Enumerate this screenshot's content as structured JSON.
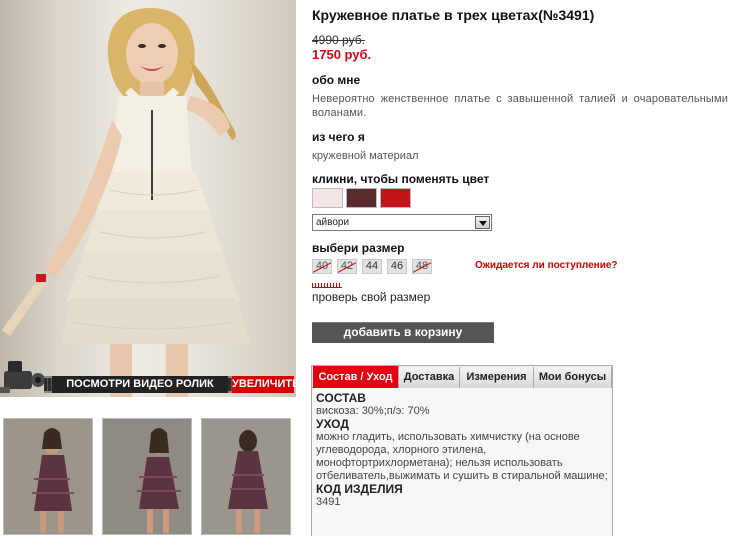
{
  "product": {
    "title": "Кружевное платье в трех цветах(№3491)",
    "old_price": "4990 руб.",
    "new_price": "1750 руб."
  },
  "about": {
    "heading": "обо мне",
    "text": "Невероятно женственное платье с завышенной талией и очаровательными воланами."
  },
  "material": {
    "heading": "из чего я",
    "text": "кружевной материал"
  },
  "color": {
    "heading": "кликни, чтобы поменять цвет",
    "swatches": [
      {
        "name": "айвори",
        "color": "#f3e6e4"
      },
      {
        "name": "бордо",
        "color": "#5a2b2e"
      },
      {
        "name": "красный",
        "color": "#c2141b"
      }
    ],
    "selected": "айвори"
  },
  "size": {
    "heading": "выбери размер",
    "options": [
      {
        "label": "40",
        "available": false
      },
      {
        "label": "42",
        "available": false
      },
      {
        "label": "44",
        "available": true
      },
      {
        "label": "46",
        "available": true
      },
      {
        "label": "48",
        "available": false
      }
    ],
    "waiting_link": "Ожидается ли поступление?",
    "check_link": "проверь свой размер"
  },
  "cart": {
    "button": "добавить в корзину"
  },
  "media": {
    "video_label": "ПОСМОТРИ ВИДЕО РОЛИК",
    "zoom_label": "УВЕЛИЧИТЬ"
  },
  "tabs": {
    "items": [
      "Состав / Уход",
      "Доставка",
      "Измерения",
      "Мои бонусы"
    ],
    "active": 0,
    "content": {
      "composition_heading": "СОСТАВ",
      "composition": "вискоза: 30%;п/э: 70%",
      "care_heading": "УХОД",
      "care": "можно гладить, использовать химчистку (на основе углеводорода, хлорного этилена, монофтортрихлорметана); нельзя использовать отбеливатель,выжимать и сушить в стиральной машине;",
      "code_heading": "КОД ИЗДЕЛИЯ",
      "code": "3491"
    }
  },
  "colors": {
    "accent": "#e3000f",
    "price": "#e0001b",
    "button": "#555555"
  }
}
